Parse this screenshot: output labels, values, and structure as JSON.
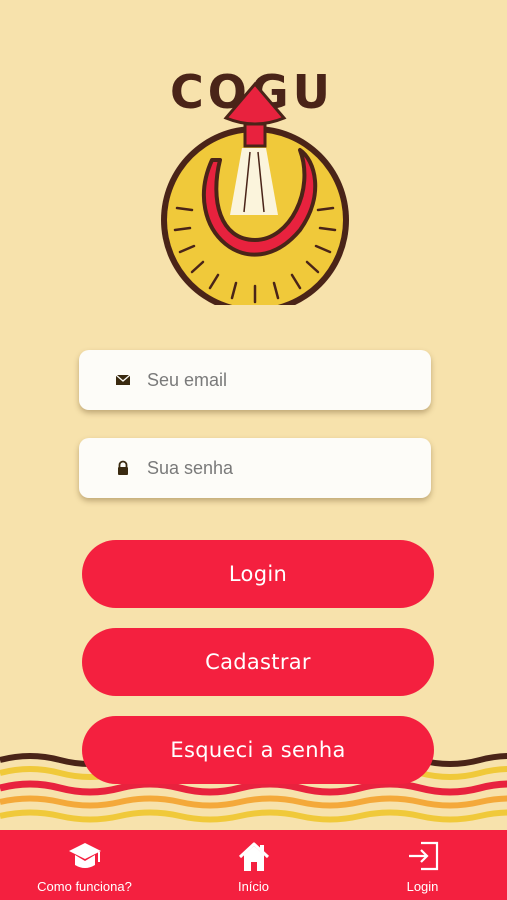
{
  "brand": {
    "logo_text": "COGU"
  },
  "form": {
    "email": {
      "placeholder": "Seu email",
      "value": ""
    },
    "password": {
      "placeholder": "Sua senha",
      "value": ""
    }
  },
  "actions": {
    "login_label": "Login",
    "register_label": "Cadastrar",
    "forgot_label": "Esqueci a senha"
  },
  "bottom_nav": {
    "items": [
      {
        "label": "Como funciona?",
        "icon": "graduation-cap-icon"
      },
      {
        "label": "Início",
        "icon": "home-icon"
      },
      {
        "label": "Login",
        "icon": "sign-in-icon"
      }
    ]
  },
  "colors": {
    "background": "#f7e2ac",
    "accent": "#f4203f",
    "logo_yellow": "#f0c93a",
    "logo_brown": "#4a2418"
  }
}
